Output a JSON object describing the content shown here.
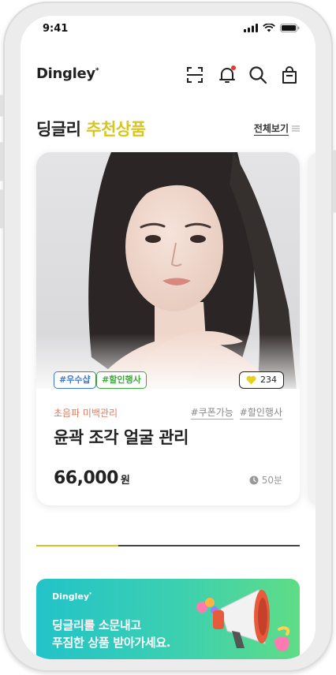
{
  "status": {
    "time": "9:41"
  },
  "header": {
    "logo": "Dingley",
    "logo_mark": "*",
    "icons": [
      "scan-icon",
      "bell-icon",
      "search-icon",
      "bag-icon"
    ],
    "notification_dot_color": "#e53935"
  },
  "section": {
    "title_main": "딩글리",
    "title_highlight": "추천상품",
    "highlight_color": "#d9c51f",
    "view_all": "전체보기"
  },
  "card": {
    "tags": [
      "#우수샵",
      "#할인행사"
    ],
    "likes": "234",
    "category": "초음파 미백관리",
    "mini_tags": [
      "#쿠폰가능",
      "#할인행사"
    ],
    "title": "윤곽 조각 얼굴 관리",
    "price": "66,000",
    "price_unit": "원",
    "duration": "50분"
  },
  "carousel": {
    "progress": 0.31
  },
  "banner": {
    "logo": "Dingley",
    "logo_mark": "*",
    "line1": "딩글리를 소문내고",
    "line2": "푸짐한 상품 받아가세요."
  }
}
